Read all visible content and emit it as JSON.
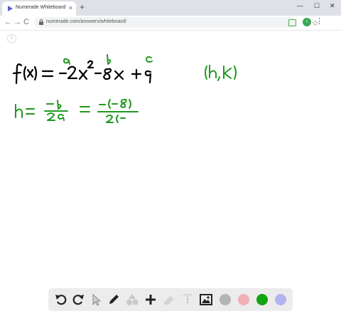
{
  "browser": {
    "tab_title": "Numerade Whiteboard",
    "tab_close": "×",
    "new_tab": "+",
    "url": "numerade.com/answers/whiteboard/",
    "avatar_letter": "i",
    "win_min": "—",
    "win_max": "☐",
    "win_close": "✕",
    "back": "←",
    "forward": "→",
    "reload": "C",
    "star": "☆",
    "menu": "⋮"
  },
  "board": {
    "ink_black": "#000000",
    "ink_green": "#1f9a1f",
    "lines": {
      "function": "f(x) = −2x² − 8x + 9",
      "labels": [
        "a",
        "b",
        "c"
      ],
      "vertex": "(h,k)",
      "formula": "h = −b/2a = −(−8)/2(−"
    },
    "info_label": "i"
  },
  "palette": {
    "tools": [
      "undo-icon",
      "redo-icon",
      "select-icon",
      "pen-icon",
      "shapes-icon",
      "plus-icon",
      "eraser-icon",
      "text-icon",
      "image-icon"
    ],
    "colors": [
      "#b4b4b4",
      "#f0b0b5",
      "#12a312",
      "#b3b3f0"
    ],
    "text_tool_label": "T"
  }
}
